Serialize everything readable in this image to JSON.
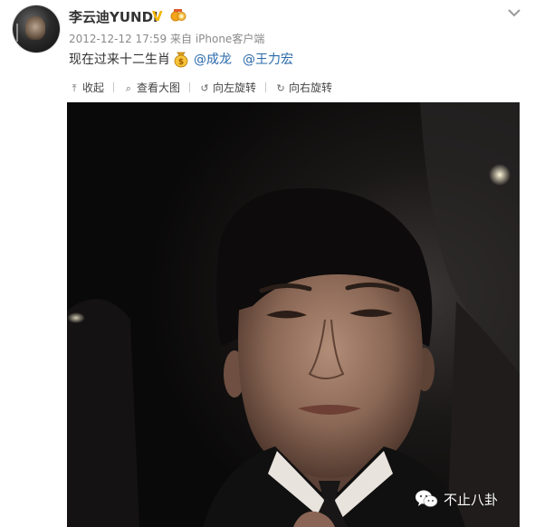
{
  "post": {
    "username": "李云迪YUNDI",
    "verified_icon": "v-badge-icon",
    "medal_icon": "medal-icon",
    "timestamp": "2012-12-12 17:59",
    "source_prefix": "来自",
    "source_client": "iPhone客户端",
    "text": "现在过来十二生肖",
    "emoji_icon": "money-bag-emoji-icon",
    "mention_1": "@成龙",
    "mention_2": "@王力宏"
  },
  "toolbar": {
    "collapse": "收起",
    "view_large": "查看大图",
    "rotate_left": "向左旋转",
    "rotate_right": "向右旋转"
  },
  "photo": {
    "description_icon": "selfie-photo"
  },
  "watermark": {
    "icon": "wechat-icon",
    "text": "不止八卦"
  },
  "colors": {
    "mention": "#2a6aaa",
    "verified": "#f6b600",
    "meta": "#8a8a8a"
  }
}
